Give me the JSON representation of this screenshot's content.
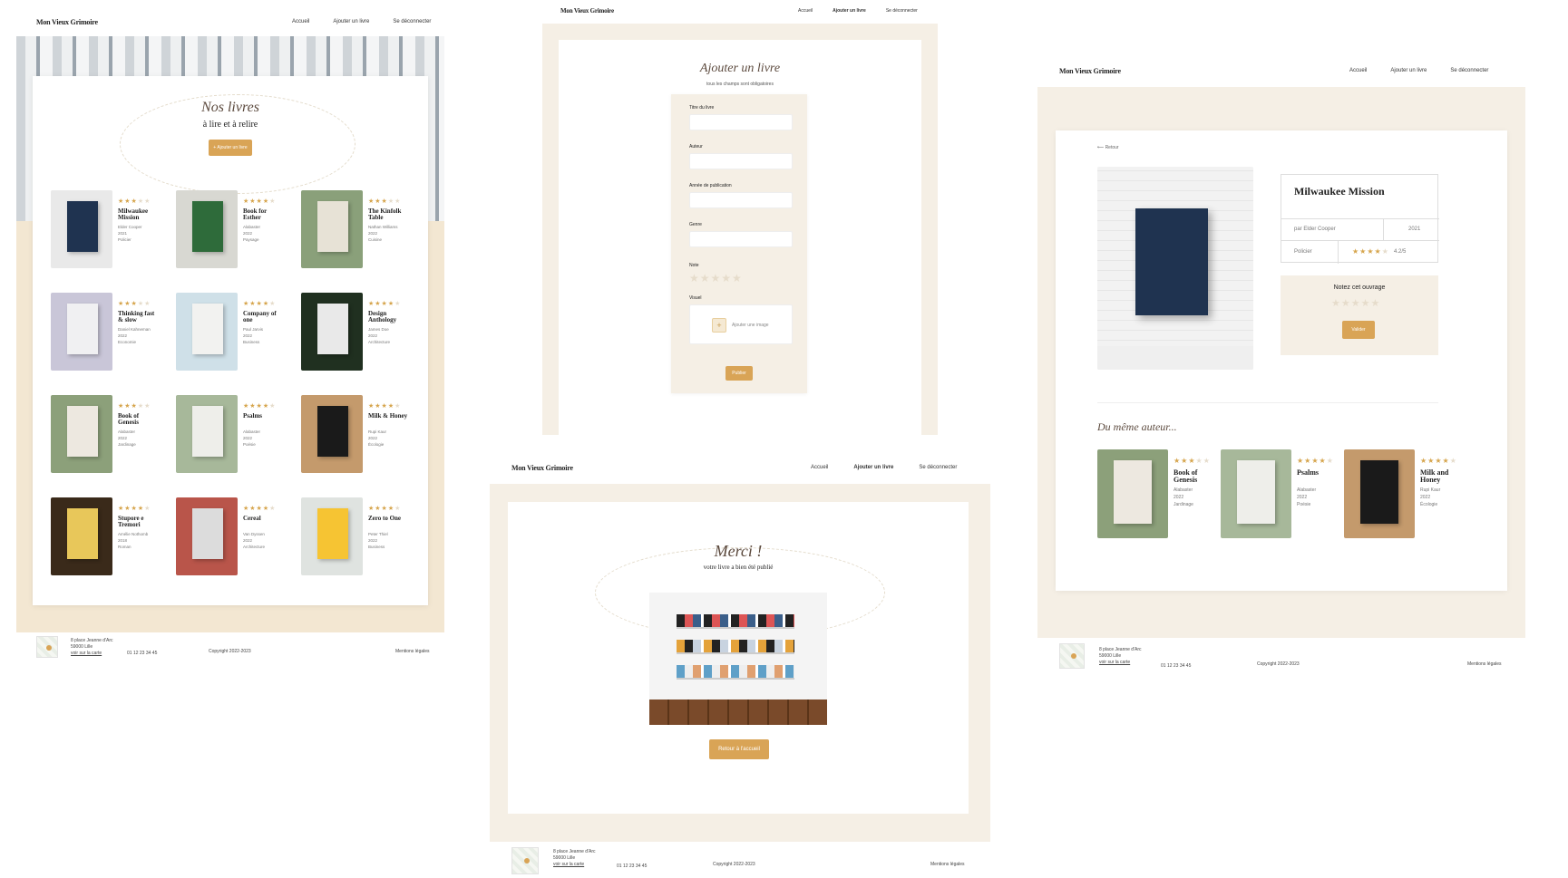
{
  "brand": "Mon Vieux Grimoire",
  "nav": {
    "home": "Accueil",
    "add": "Ajouter un livre",
    "logout": "Se déconnecter"
  },
  "footer": {
    "address1": "8 place Jeanne d'Arc",
    "address2": "59000 Lille",
    "map_link": "voir sur la carte",
    "phone": "01 12 23 34 45",
    "copyright": "Copyright 2022-2023",
    "legal": "Mentions légales"
  },
  "home": {
    "title": "Nos livres",
    "subtitle": "à lire et à relire",
    "add_button": "+ Ajouter un livre",
    "books": [
      {
        "title": "Milwaukee Mission",
        "author": "Elder Cooper",
        "year": "2021",
        "genre": "Policier",
        "rating": 3,
        "cover": "#1f3350",
        "bg": "#e9e9e9"
      },
      {
        "title": "Book for Esther",
        "author": "Alabaster",
        "year": "2022",
        "genre": "Paysage",
        "rating": 4,
        "cover": "#2e6b3a",
        "bg": "#d8d8d2"
      },
      {
        "title": "The Kinfolk Table",
        "author": "Nathan Williams",
        "year": "2022",
        "genre": "Cuisine",
        "rating": 3,
        "cover": "#e7e2d6",
        "bg": "#8aa07a"
      },
      {
        "title": "Thinking fast & slow",
        "author": "Daniel Kahneman",
        "year": "2022",
        "genre": "Economie",
        "rating": 3,
        "cover": "#f0f0f2",
        "bg": "#c9c6d8"
      },
      {
        "title": "Company of one",
        "author": "Paul Jarvis",
        "year": "2022",
        "genre": "Business",
        "rating": 4,
        "cover": "#f2f2f0",
        "bg": "#cfe0e8"
      },
      {
        "title": "Design Anthology",
        "author": "James Doe",
        "year": "2022",
        "genre": "Architecture",
        "rating": 4,
        "cover": "#e9e9e9",
        "bg": "#203020"
      },
      {
        "title": "Book of Genesis",
        "author": "Alabaster",
        "year": "2022",
        "genre": "Jardinage",
        "rating": 3,
        "cover": "#ede8e0",
        "bg": "#8ca07a"
      },
      {
        "title": "Psalms",
        "author": "Alabaster",
        "year": "2022",
        "genre": "Poésie",
        "rating": 4,
        "cover": "#eeeeea",
        "bg": "#a7b89a"
      },
      {
        "title": "Milk & Honey",
        "author": "Rupi Kaur",
        "year": "2022",
        "genre": "Écologie",
        "rating": 4,
        "cover": "#1a1a1a",
        "bg": "#c49a6c"
      },
      {
        "title": "Stupore e Tremori",
        "author": "Amélie Nothomb",
        "year": "2018",
        "genre": "Roman",
        "rating": 4,
        "cover": "#e8c75a",
        "bg": "#3a2a1a"
      },
      {
        "title": "Cereal",
        "author": "Van Dyssen",
        "year": "2022",
        "genre": "Architecture",
        "rating": 4,
        "cover": "#dcdcdc",
        "bg": "#b9554a"
      },
      {
        "title": "Zero to One",
        "author": "Peter Thiel",
        "year": "2022",
        "genre": "Business",
        "rating": 4,
        "cover": "#f6c433",
        "bg": "#dfe3e0"
      }
    ]
  },
  "add_form": {
    "title": "Ajouter un livre",
    "subtitle": "tous les champs sont obligatoires",
    "fields": [
      "Titre du livre",
      "Auteur",
      "Année de publication",
      "Genre"
    ],
    "note_label": "Note",
    "visual_label": "Visuel",
    "add_image": "Ajouter une image",
    "submit": "Publier"
  },
  "detail": {
    "back": "Retour",
    "title": "Milwaukee Mission",
    "author": "par Elder Cooper",
    "year": "2021",
    "genre": "Policier",
    "rating_text": "4.2/5",
    "rating": 4,
    "rate_title": "Notez cet ouvrage",
    "rate_button": "Valider",
    "same_author": "Du même auteur...",
    "related": [
      {
        "title": "Book of Genesis",
        "author": "Alabaster",
        "year": "2022",
        "genre": "Jardinage",
        "rating": 3,
        "cover": "#ede8e0",
        "bg": "#8ca07a"
      },
      {
        "title": "Psalms",
        "author": "Alabaster",
        "year": "2022",
        "genre": "Poésie",
        "rating": 4,
        "cover": "#eeeeea",
        "bg": "#a7b89a"
      },
      {
        "title": "Milk and Honey",
        "author": "Rupi Kaur",
        "year": "2022",
        "genre": "Écologie",
        "rating": 4,
        "cover": "#1a1a1a",
        "bg": "#c49a6c"
      }
    ]
  },
  "thanks": {
    "title": "Merci !",
    "subtitle": "votre livre a bien été publié",
    "button": "Retour à l'accueil"
  }
}
